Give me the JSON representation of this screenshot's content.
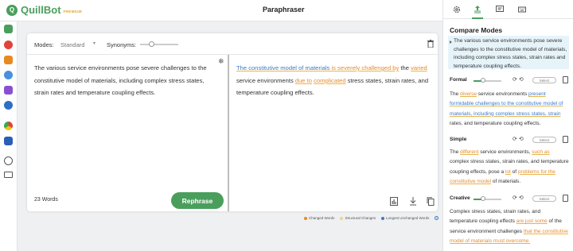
{
  "header": {
    "logo_text": "QuillBot",
    "logo_badge": "PREMIUM",
    "title": "Paraphraser"
  },
  "toolbar": {
    "modes_label": "Modes:",
    "mode_value": "Standard",
    "synonyms_label": "Synonyms:"
  },
  "input": {
    "text": "The various service environments pose severe challenges to the constitutive model of materials, including complex stress states, strain rates and temperature coupling effects.",
    "word_count": "23 Words"
  },
  "output": {
    "segments": [
      {
        "t": "The constitutive model of materials ",
        "c": "blue"
      },
      {
        "t": "is severely challenged by",
        "c": "chg"
      },
      {
        "t": " the ",
        "c": "plain"
      },
      {
        "t": "varied",
        "c": "chg"
      },
      {
        "t": " service environments ",
        "c": "plain"
      },
      {
        "t": "due to",
        "c": "chg"
      },
      {
        "t": " ",
        "c": "plain"
      },
      {
        "t": "complicated",
        "c": "chg"
      },
      {
        "t": " stress states, strain rates, and temperature coupling effects.",
        "c": "plain"
      }
    ]
  },
  "actions": {
    "rephrase_label": "Rephrase"
  },
  "legend": {
    "changed": "Changed Words",
    "structural": "Structural Changes",
    "unchanged": "Longest Unchanged Words",
    "info": "i"
  },
  "compare": {
    "title": "Compare Modes",
    "original": "The various service environments pose severe challenges to the constitutive model of materials, including complex stress states, strain rates and temperature coupling effects.",
    "select_label": "Select",
    "modes": [
      {
        "name": "Formal",
        "level": 0.35,
        "segments": [
          {
            "t": "The ",
            "c": "plain"
          },
          {
            "t": "diverse",
            "c": "chg"
          },
          {
            "t": " service environments ",
            "c": "plain"
          },
          {
            "t": "present formidable challenges to the constitutive model of materials, including complex stress states,",
            "c": "blue"
          },
          {
            "t": " strain",
            "c": "blue"
          },
          {
            "t": " rates, and temperature coupling effects.",
            "c": "plain"
          }
        ]
      },
      {
        "name": "Simple",
        "level": 0,
        "segments": [
          {
            "t": "The ",
            "c": "plain"
          },
          {
            "t": "different",
            "c": "chg"
          },
          {
            "t": " service environments, ",
            "c": "plain"
          },
          {
            "t": "such as",
            "c": "chg"
          },
          {
            "t": " complex stress states, strain rates, and temperature coupling effects, pose a ",
            "c": "plain"
          },
          {
            "t": "lot",
            "c": "chg"
          },
          {
            "t": " of ",
            "c": "plain"
          },
          {
            "t": "problems for the constitutive model",
            "c": "chg"
          },
          {
            "t": " of materials.",
            "c": "plain"
          }
        ]
      },
      {
        "name": "Creative",
        "level": 0.35,
        "segments": [
          {
            "t": "Complex stress states, strain rates, and temperature coupling effects ",
            "c": "plain"
          },
          {
            "t": "are just some",
            "c": "chg"
          },
          {
            "t": " of the service environment challenges ",
            "c": "plain"
          },
          {
            "t": "that the constitutive model of materials must overcome.",
            "c": "chg"
          }
        ]
      }
    ]
  },
  "colors": {
    "brand": "#4a9e5c",
    "changed": "#e58b2b",
    "structural": "#e8b44a",
    "unchanged": "#3a7ac9"
  }
}
